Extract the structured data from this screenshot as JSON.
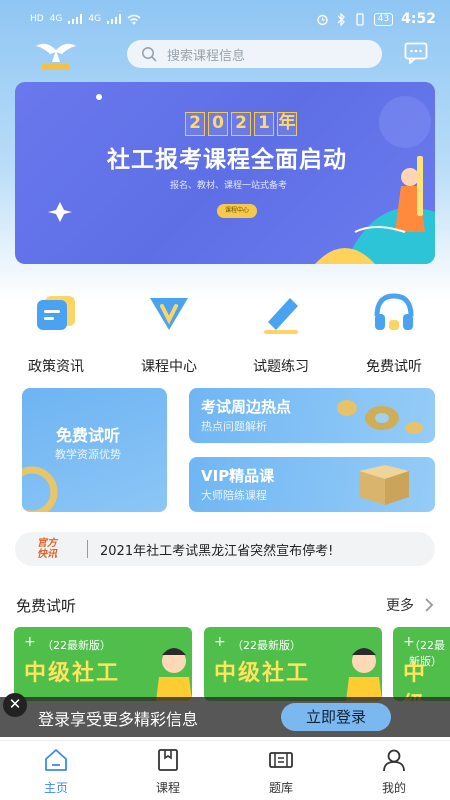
{
  "status_bar": {
    "left": [
      "HD",
      "4G",
      "4G"
    ],
    "battery": "43",
    "time": "4:52"
  },
  "header": {
    "search_placeholder": "搜索课程信息"
  },
  "banner": {
    "year_chars": [
      "2",
      "0",
      "2",
      "1",
      "年"
    ],
    "title": "社工报考课程全面启动",
    "subtitle": "报名、教材、课程一站式备考",
    "button": "课程中心"
  },
  "quick_links": [
    {
      "label": "政策资讯",
      "icon": "document-icon"
    },
    {
      "label": "课程中心",
      "icon": "v-badge-icon"
    },
    {
      "label": "试题练习",
      "icon": "pencil-icon"
    },
    {
      "label": "免费试听",
      "icon": "headphones-icon"
    }
  ],
  "cards": {
    "big": {
      "title": "免费试听",
      "subtitle": "教学资源优势"
    },
    "small": [
      {
        "title": "考试周边热点",
        "subtitle": "热点问题解析"
      },
      {
        "title": "VIP精品课",
        "subtitle": "大师陪练课程"
      }
    ]
  },
  "news": {
    "badge_line1": "官方",
    "badge_line2": "快讯",
    "text": "2021年社工考试黑龙江省突然宣布停考!"
  },
  "section": {
    "title": "免费试听",
    "more": "更多"
  },
  "courses": [
    {
      "tag": "（22最新版）",
      "name": "中级社工"
    },
    {
      "tag": "（22最新版）",
      "name": "中级社工"
    },
    {
      "tag": "（22最新版）",
      "name": "中级社工"
    }
  ],
  "login_bar": {
    "close": "✕",
    "text": "登录享受更多精彩信息",
    "button": "立即登录"
  },
  "tabs": [
    {
      "label": "主页",
      "icon": "home-icon",
      "active": true
    },
    {
      "label": "课程",
      "icon": "course-icon",
      "active": false
    },
    {
      "label": "题库",
      "icon": "question-bank-icon",
      "active": false
    },
    {
      "label": "我的",
      "icon": "profile-icon",
      "active": false
    }
  ],
  "colors": {
    "accent": "#3b8be8",
    "banner": "#6a78ec",
    "course_green": "#4fbe4a",
    "course_title": "#ffe45e"
  }
}
